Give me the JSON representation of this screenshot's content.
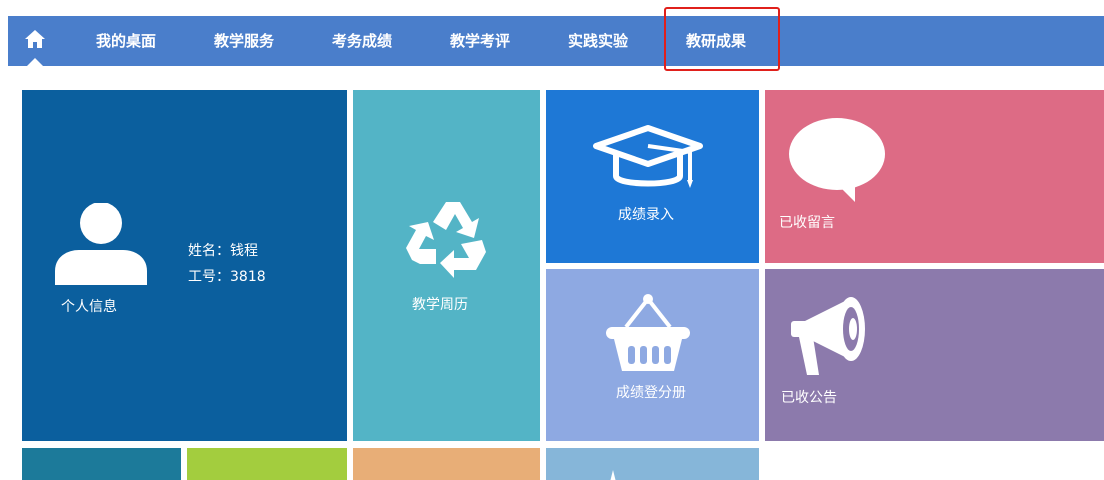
{
  "nav": {
    "home_icon": "home-icon",
    "items": [
      {
        "label": "我的桌面"
      },
      {
        "label": "教学服务"
      },
      {
        "label": "考务成绩"
      },
      {
        "label": "教学考评"
      },
      {
        "label": "实践实验"
      },
      {
        "label": "教研成果"
      }
    ],
    "highlighted_item": "教研成果",
    "bar_color": "#4a7ecb",
    "highlight_color": "#e0201b"
  },
  "tiles": {
    "personal_info": {
      "label": "个人信息",
      "name_line": "姓名：钱程",
      "id_line": "工号：3818",
      "icon": "user-icon",
      "color": "#0b5f9e"
    },
    "teaching_calendar": {
      "label": "教学周历",
      "icon": "recycle-icon",
      "color": "#53b4c6"
    },
    "grade_entry": {
      "label": "成绩录入",
      "icon": "graduation-cap-icon",
      "color": "#1e78d6"
    },
    "received_messages": {
      "label": "已收留言",
      "icon": "speech-bubble-icon",
      "color": "#dd6b85"
    },
    "grade_register": {
      "label": "成绩登分册",
      "icon": "basket-icon",
      "color": "#8ea9e2"
    },
    "received_notices": {
      "label": "已收公告",
      "icon": "megaphone-icon",
      "color": "#8c7aac"
    },
    "bottom_row_colors": [
      "#1c7a9a",
      "#a3cd3e",
      "#e8ae77",
      "#86b6d9"
    ]
  }
}
